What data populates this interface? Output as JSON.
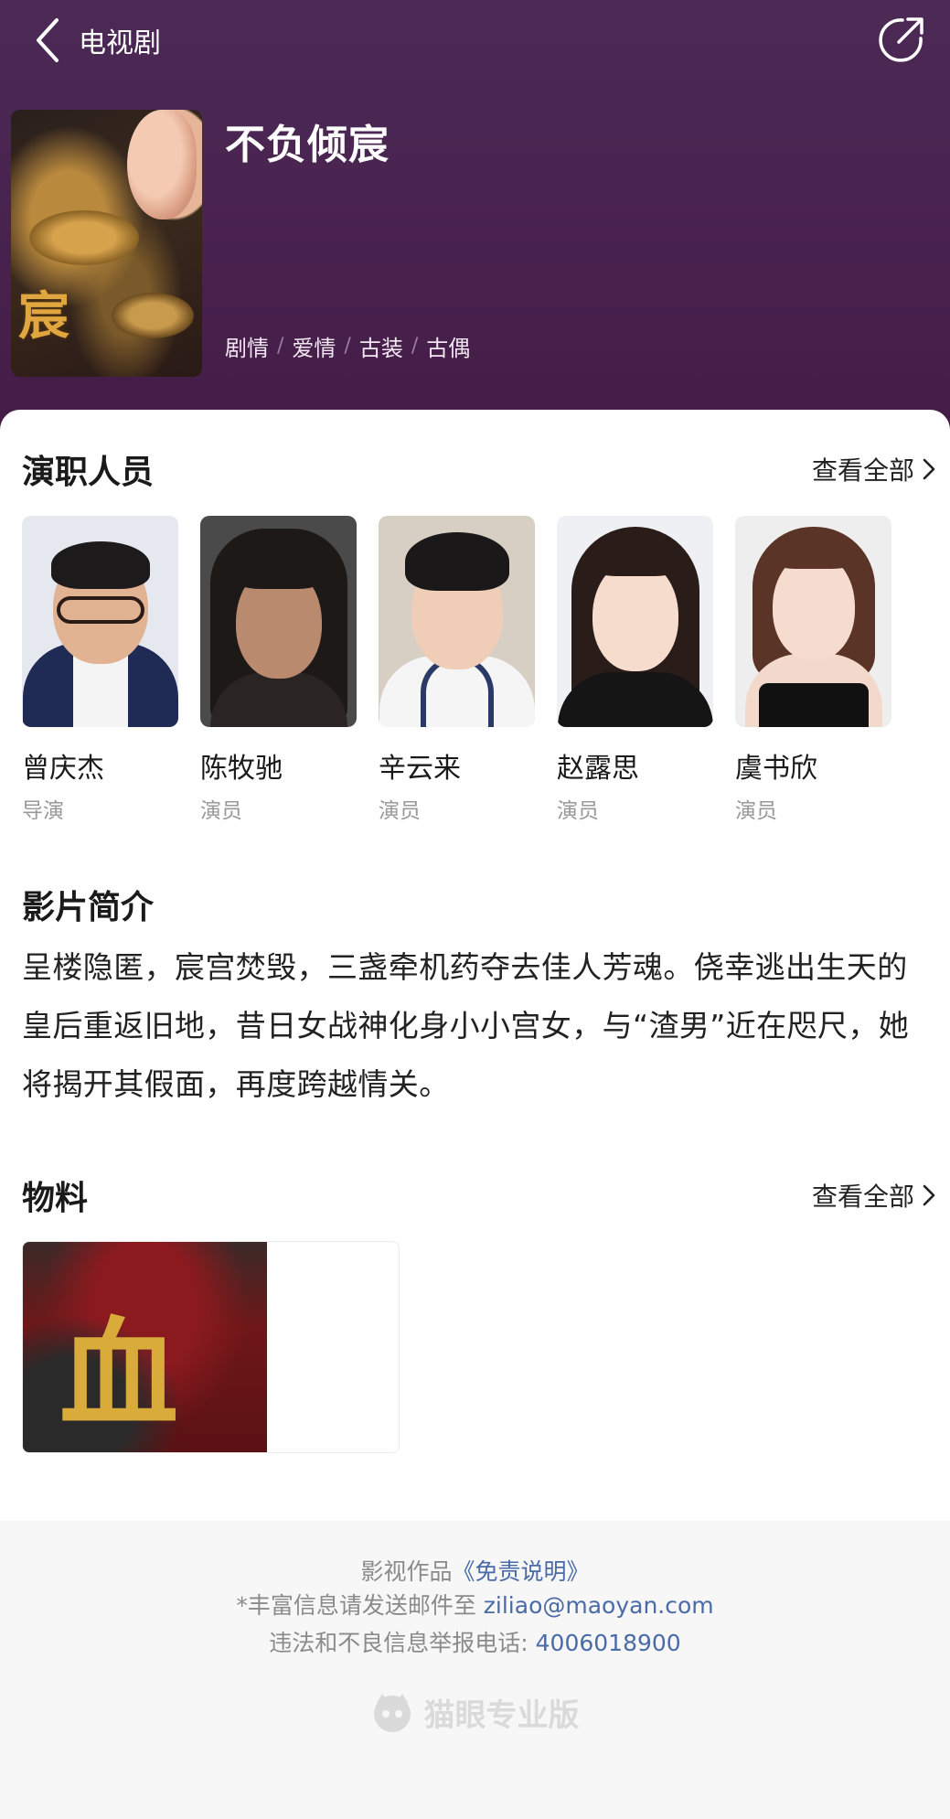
{
  "nav": {
    "back_label": "电视剧"
  },
  "show": {
    "title": "不负倾宸",
    "poster_char": "宸",
    "genres": [
      "剧情",
      "爱情",
      "古装",
      "古偶"
    ],
    "genre_sep": "/"
  },
  "cast_section": {
    "title": "演职人员",
    "see_all": "查看全部",
    "people": [
      {
        "name": "曾庆杰",
        "role": "导演"
      },
      {
        "name": "陈牧驰",
        "role": "演员"
      },
      {
        "name": "辛云来",
        "role": "演员"
      },
      {
        "name": "赵露思",
        "role": "演员"
      },
      {
        "name": "虞书欣",
        "role": "演员"
      }
    ]
  },
  "synopsis_section": {
    "title": "影片简介",
    "text": "呈楼隐匿，宸宫焚毁，三盏牵机药夺去佳人芳魂。侥幸逃出生天的皇后重返旧地，昔日女战神化身小小宫女，与“渣男”近在咫尺，她将揭开其假面，再度跨越情关。"
  },
  "media_section": {
    "title": "物料",
    "see_all": "查看全部",
    "thumb_glyph": "血"
  },
  "footer": {
    "disclaimer_prefix": "影视作品",
    "disclaimer_link": "《免责说明》",
    "email_prefix": "*丰富信息请发送邮件至 ",
    "email": "ziliao@maoyan.com",
    "report_prefix": "违法和不良信息举报电话: ",
    "report_phone": "4006018900",
    "brand": "猫眼专业版"
  },
  "colors": {
    "header_bg": "#4a2450",
    "link": "#4a6aa8"
  }
}
